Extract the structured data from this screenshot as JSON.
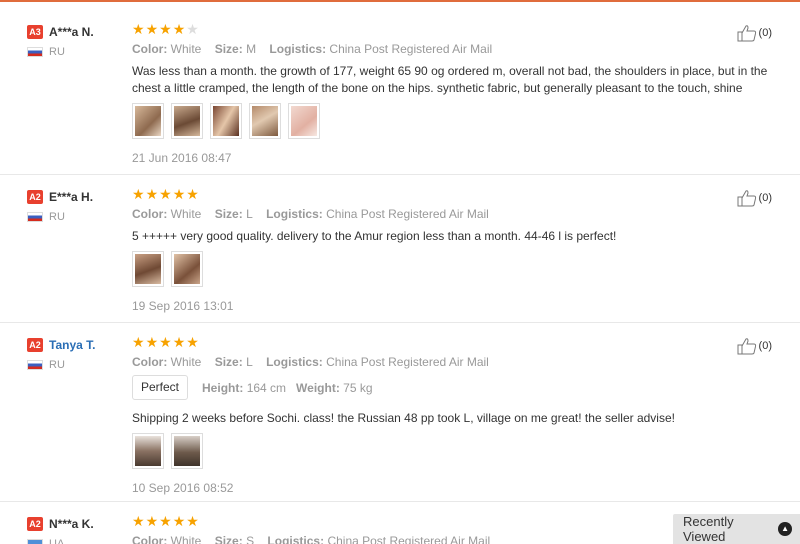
{
  "labels": {
    "color": "Color:",
    "size": "Size:",
    "logistics": "Logistics:",
    "height": "Height:",
    "weight": "Weight:"
  },
  "reviews": [
    {
      "level": "A3",
      "name": "A***a N.",
      "country": "RU",
      "rating": 4,
      "color": "White",
      "size": "M",
      "logistics": "China Post Registered Air Mail",
      "text": "Was less than a month. the growth of 177, weight 65 90 og ordered m, overall not bad, the shoulders in place, but in the chest a little cramped, the length of the bone on the hips. synthetic fabric, but generally pleasant to the touch, shine",
      "photos": 5,
      "date": "21 Jun 2016 08:47",
      "helpful": "(0)"
    },
    {
      "level": "A2",
      "name": "E***a H.",
      "country": "RU",
      "rating": 5,
      "color": "White",
      "size": "L",
      "logistics": "China Post Registered Air Mail",
      "text": "5 +++++ very good quality. delivery to the Amur region less than a month. 44-46 l is perfect!",
      "photos": 2,
      "date": "19 Sep 2016 13:01",
      "helpful": "(0)"
    },
    {
      "level": "A2",
      "name": "Tanya T.",
      "country": "RU",
      "rating": 5,
      "color": "White",
      "size": "L",
      "logistics": "China Post Registered Air Mail",
      "fit": "Perfect",
      "height": "164 cm",
      "weight": "75 kg",
      "text": "Shipping 2 weeks before Sochi. class! the Russian 48 pp took L, village on me great! the seller advise!",
      "photos": 2,
      "date": "10 Sep 2016 08:52",
      "helpful": "(0)"
    },
    {
      "level": "A2",
      "name": "N***a K.",
      "country": "UA",
      "rating": 5,
      "color": "White",
      "size": "S",
      "logistics": "China Post Registered Air Mail"
    }
  ],
  "recently_viewed": {
    "label": "Recently Viewed",
    "icon": "chevron-up-icon"
  },
  "colors": {
    "star": "#f7a200",
    "badge": "#e8402e",
    "link": "#2a6eb5",
    "accent": "#e06c3c"
  }
}
